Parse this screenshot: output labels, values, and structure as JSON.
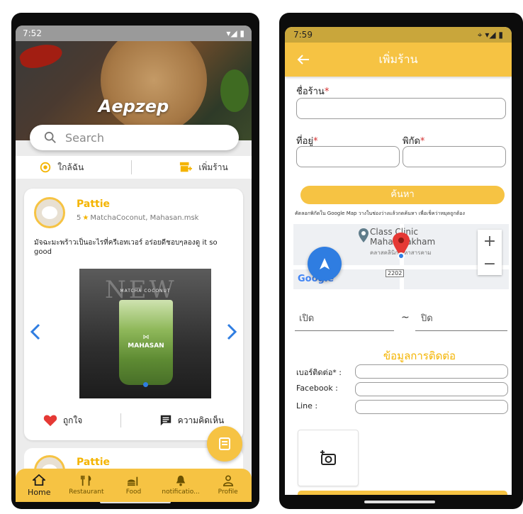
{
  "screen1": {
    "status": {
      "time": "7:52"
    },
    "brand": "Aepzep",
    "search": {
      "placeholder": "Search"
    },
    "quick_actions": [
      {
        "label": "ใกล้ฉัน",
        "icon": "location-target-icon"
      },
      {
        "label": "เพิ่มร้าน",
        "icon": "add-store-icon"
      }
    ],
    "post": {
      "user": "Pattie",
      "rating": "5",
      "meta": "MatchaCoconut, Mahasan.msk",
      "text": "มัจฉะมะพร้าวเป็นอะไรที่ครีเอทเวอร์ อร่อยดีชอบๆลองดู it so good",
      "photo_overlay": "NEW",
      "photo_caption": "MATCHA COCONUT",
      "photo_brand": "MAHASAN",
      "like_label": "ถูกใจ",
      "comment_label": "ความคิดเห็น"
    },
    "post2": {
      "user": "Pattie"
    },
    "nav": [
      {
        "label": "Home",
        "icon": "home-icon",
        "active": true
      },
      {
        "label": "Restaurant",
        "icon": "fork-knife-icon",
        "active": false
      },
      {
        "label": "Food",
        "icon": "food-icon",
        "active": false
      },
      {
        "label": "notificatio...",
        "icon": "bell-icon",
        "active": false
      },
      {
        "label": "Profile",
        "icon": "profile-icon",
        "active": false
      }
    ],
    "colors": {
      "accent": "#f6c343",
      "name": "#f4b400",
      "arrow": "#2f7de1",
      "heart": "#e53935"
    }
  },
  "screen2": {
    "status": {
      "time": "7:59"
    },
    "title": "เพิ่มร้าน",
    "store_name_label": "ชื่อร้าน",
    "address_label": "ที่อยู่",
    "coords_label": "พิกัด",
    "required_mark": "*",
    "search_button": "ค้นหา",
    "hint": "คัดลอกพิกัดใน Google Map วางในช่องว่างแล้วกดค้นหา เพื่อเช็คว่าหมุดถูกต้อง",
    "map": {
      "place_line1": "Class Clinic",
      "place_line2": "Mahasarakham",
      "place_sub": "คลาสคลินิก มหาสารคาม",
      "google": "Google",
      "road_number": "2202",
      "zoom_in": "+",
      "zoom_out": "−"
    },
    "open_label": "เปิด",
    "tilde": "~",
    "close_label": "ปิด",
    "contact_title": "ข้อมูลการติดต่อ",
    "phone_label": "เบอร์ติดต่อ",
    "facebook_label": "Facebook :",
    "line_label": "Line :"
  }
}
